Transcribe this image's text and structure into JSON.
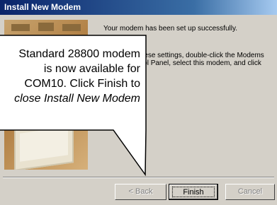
{
  "window": {
    "title": "Install New Modem"
  },
  "wizard": {
    "success_text": "Your modem has been set up successfully.",
    "change_text": "To change these settings, double-click the Modems icon in Control Panel, select this modem, and click Properties.",
    "back_label": "< Back",
    "finish_label": "Finish",
    "cancel_label": "Cancel"
  },
  "callout": {
    "line1": "Standard 28800 modem",
    "line2": "is now available for",
    "line3": "COM10. Click Finish to",
    "line4_italic": "close Install New Modem"
  }
}
